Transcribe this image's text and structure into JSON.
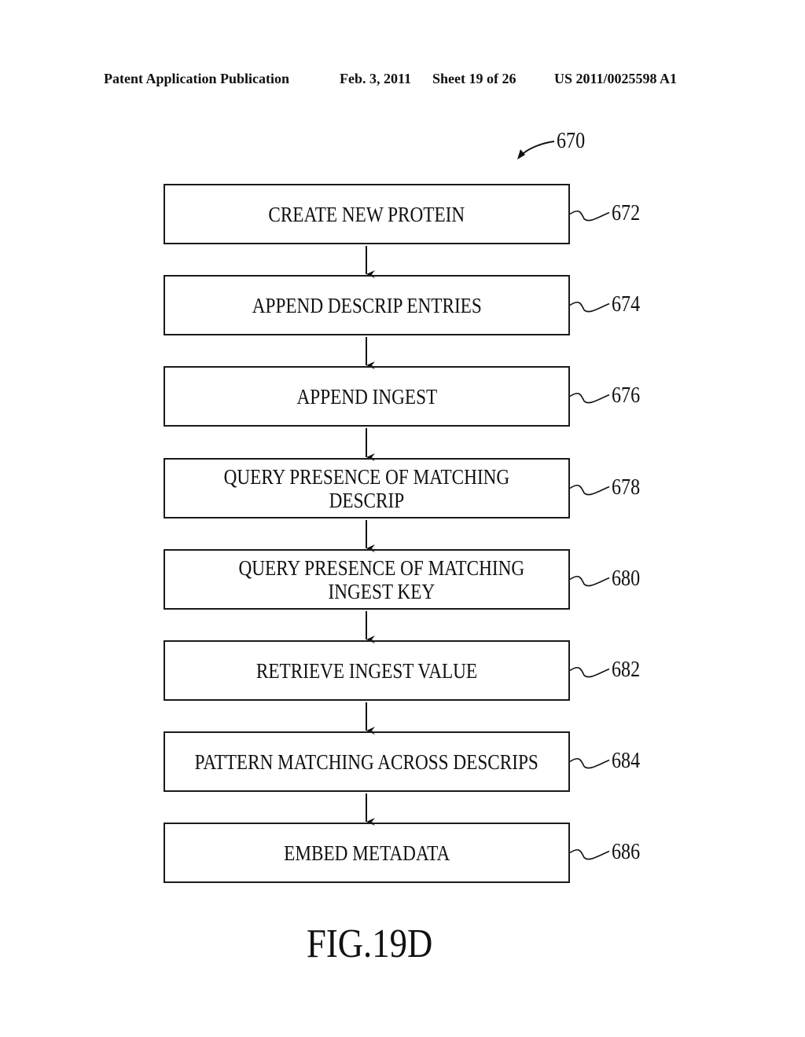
{
  "header": {
    "left": "Patent Application Publication",
    "date": "Feb. 3, 2011",
    "sheet": "Sheet 19 of 26",
    "pub_number": "US 2011/0025598 A1"
  },
  "diagram_ref": "670",
  "steps": [
    {
      "label": "CREATE NEW PROTEIN",
      "ref": "672"
    },
    {
      "label": "APPEND DESCRIP ENTRIES",
      "ref": "674"
    },
    {
      "label": "APPEND INGEST",
      "ref": "676"
    },
    {
      "label": "QUERY PRESENCE OF MATCHING\nDESCRIP",
      "ref": "678"
    },
    {
      "label": "QUERY PRESENCE OF MATCHING\nINGEST KEY",
      "ref": "680"
    },
    {
      "label": "RETRIEVE INGEST VALUE",
      "ref": "682"
    },
    {
      "label": "PATTERN MATCHING ACROSS DESCRIPS",
      "ref": "684"
    },
    {
      "label": "EMBED METADATA",
      "ref": "686"
    }
  ],
  "figure_label": "FIG.19D"
}
